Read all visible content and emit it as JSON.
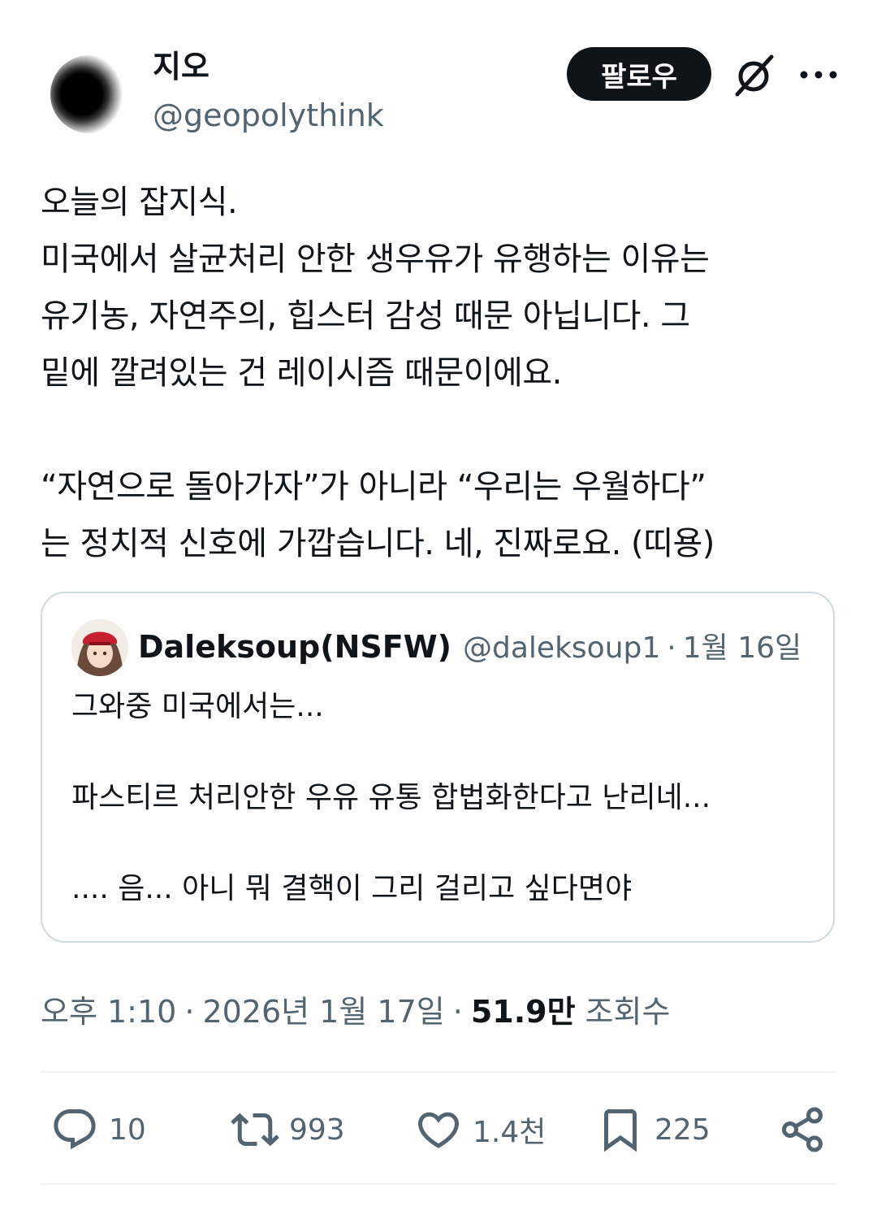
{
  "author": {
    "display_name": "지오",
    "handle": "@geopolythink",
    "follow_label": "팔로우"
  },
  "icons": {
    "grok": "grok-icon",
    "more": "more-icon",
    "reply": "reply-icon",
    "repost": "repost-icon",
    "like": "heart-icon",
    "bookmark": "bookmark-icon",
    "share": "share-icon"
  },
  "post": {
    "text": "오늘의 잡지식.\n미국에서 살균처리 안한 생우유가 유행하는 이유는\n유기농, 자연주의, 힙스터 감성 때문 아닙니다. 그\n밑에 깔려있는 건 레이시즘 때문이에요.\n\n“자연으로 돌아가자”가 아니라 “우리는 우월하다”\n는 정치적 신호에 가깝습니다. 네, 진짜로요. (띠용)"
  },
  "quote": {
    "display_name": "Daleksoup(NSFW)",
    "handle": "@daleksoup1",
    "separator": "·",
    "date": "1월 16일",
    "text": "그와중 미국에서는...\n\n파스티르 처리안한 우유 유통 합법화한다고 난리네...\n\n.... 음... 아니 뭐 결핵이 그리 걸리고 싶다면야"
  },
  "meta": {
    "time": "오후 1:10",
    "sep": "·",
    "date": "2026년 1월 17일",
    "views_count": "51.9만",
    "views_label": "조회수"
  },
  "actions": {
    "replies": "10",
    "reposts": "993",
    "likes": "1.4천",
    "bookmarks": "225"
  },
  "colors": {
    "text": "#0f1419",
    "secondary": "#536471",
    "border": "#cfd9de",
    "button_bg": "#0f1419"
  }
}
